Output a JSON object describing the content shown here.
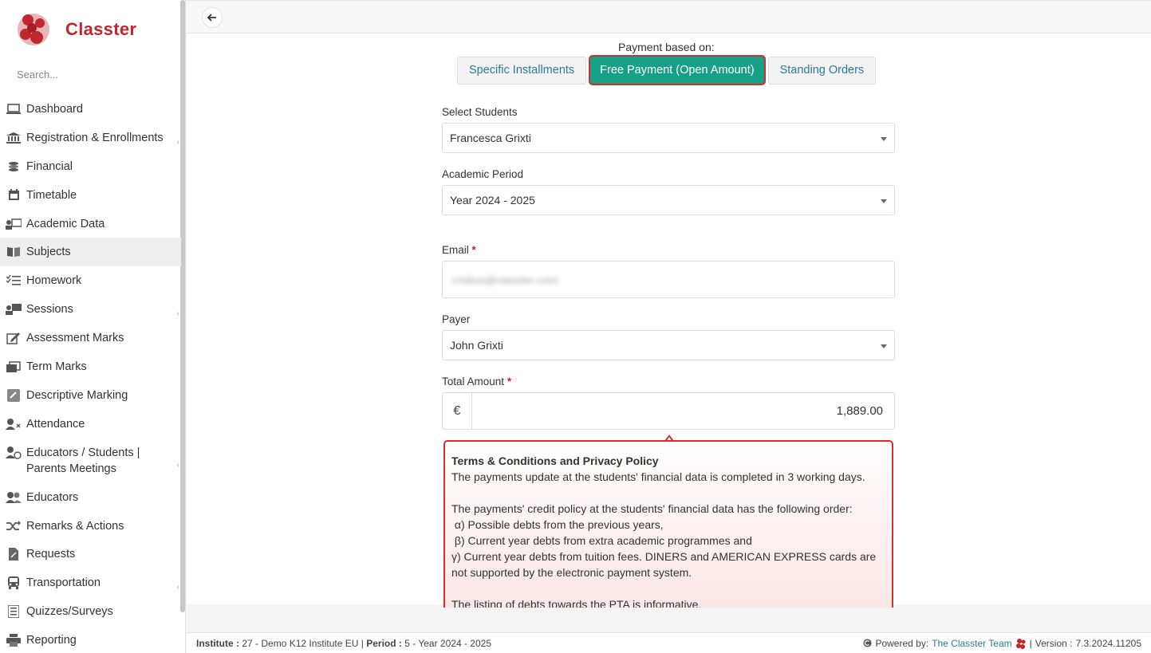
{
  "app": {
    "name": "Classter",
    "brand_color": "#c0262e",
    "accent_color": "#17a085"
  },
  "sidebar": {
    "search_placeholder": "Search...",
    "items": [
      {
        "label": "Dashboard",
        "icon": "laptop-icon",
        "has_children": false,
        "active": false
      },
      {
        "label": "Registration & Enrollments",
        "icon": "institution-icon",
        "has_children": true,
        "active": false
      },
      {
        "label": "Financial",
        "icon": "coins-icon",
        "has_children": false,
        "active": false
      },
      {
        "label": "Timetable",
        "icon": "calendar-icon",
        "has_children": false,
        "active": false
      },
      {
        "label": "Academic Data",
        "icon": "presentation-icon",
        "has_children": false,
        "active": false
      },
      {
        "label": "Subjects",
        "icon": "book-icon",
        "has_children": false,
        "active": true
      },
      {
        "label": "Homework",
        "icon": "checklist-icon",
        "has_children": false,
        "active": false
      },
      {
        "label": "Sessions",
        "icon": "teacher-board-icon",
        "has_children": true,
        "active": false
      },
      {
        "label": "Assessment Marks",
        "icon": "edit-icon",
        "has_children": false,
        "active": false
      },
      {
        "label": "Term Marks",
        "icon": "cards-icon",
        "has_children": false,
        "active": false
      },
      {
        "label": "Descriptive Marking",
        "icon": "marking-icon",
        "has_children": false,
        "active": false
      },
      {
        "label": "Attendance",
        "icon": "user-x-icon",
        "has_children": false,
        "active": false
      },
      {
        "label": "Educators / Students | Parents Meetings",
        "icon": "user-clock-icon",
        "has_children": true,
        "active": false
      },
      {
        "label": "Educators",
        "icon": "users-icon",
        "has_children": false,
        "active": false
      },
      {
        "label": "Remarks & Actions",
        "icon": "shuffle-icon",
        "has_children": false,
        "active": false
      },
      {
        "label": "Requests",
        "icon": "document-icon",
        "has_children": false,
        "active": false
      },
      {
        "label": "Transportation",
        "icon": "bus-icon",
        "has_children": true,
        "active": false
      },
      {
        "label": "Quizzes/Surveys",
        "icon": "list-icon",
        "has_children": false,
        "active": false
      },
      {
        "label": "Reporting",
        "icon": "printer-icon",
        "has_children": false,
        "active": false
      }
    ]
  },
  "topbar": {
    "back_icon": "arrow-left-icon"
  },
  "payment": {
    "based_on_label": "Payment based on:",
    "tabs": [
      {
        "label": "Specific Installments",
        "active": false
      },
      {
        "label": "Free Payment (Open Amount)",
        "active": true
      },
      {
        "label": "Standing Orders",
        "active": false
      }
    ]
  },
  "form": {
    "students": {
      "label": "Select Students",
      "value": "Francesca Grixti"
    },
    "academic_period": {
      "label": "Academic Period",
      "value": "Year 2024 - 2025"
    },
    "email": {
      "label": "Email",
      "required_mark": "*",
      "value": "cridius@classter.com"
    },
    "payer": {
      "label": "Payer",
      "value": "John Grixti"
    },
    "total_amount": {
      "label": "Total Amount",
      "required_mark": "*",
      "currency": "€",
      "value": "1,889.00"
    }
  },
  "terms": {
    "title": "Terms & Conditions and Privacy Policy",
    "para1": "The payments update at the students' financial data is completed in 3 working days.",
    "para2_intro": "The payments' credit policy at the students' financial data has the following order:",
    "item_a": " α) Possible debts from the previous years,",
    "item_b": " β) Current year debts from extra academic programmes and",
    "item_c": " γ) Current year debts from tuition fees. DINERS and AMERICAN EXPRESS cards are not supported by the electronic payment system.",
    "para3": "The listing of debts towards the PTA is informative."
  },
  "footer": {
    "institute_label": "Institute :",
    "institute_value": "27 - Demo K12 Institute EU",
    "period_label": "Period :",
    "period_value": "5 - Year 2024 - 2025",
    "powered_by": "Powered by:",
    "team": "The Classter Team",
    "version_label": "Version :",
    "version_value": "7.3.2024.11205"
  }
}
